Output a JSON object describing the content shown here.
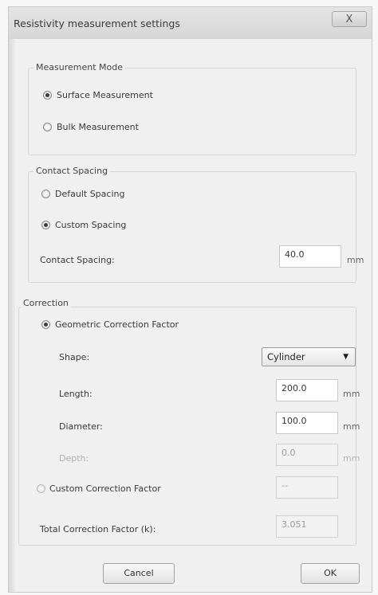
{
  "window": {
    "title": "Resistivity measurement settings",
    "close_label": "X"
  },
  "measurement_mode": {
    "legend": "Measurement Mode",
    "surface_label": "Surface Measurement",
    "bulk_label": "Bulk Measurement",
    "selected": "surface"
  },
  "contact_spacing": {
    "legend": "Contact Spacing",
    "default_label": "Default Spacing",
    "custom_label": "Custom Spacing",
    "selected": "custom",
    "field_label": "Contact Spacing:",
    "value": "40.0",
    "unit": "mm"
  },
  "correction": {
    "legend": "Correction",
    "geometric_label": "Geometric Correction Factor",
    "selected": "geometric",
    "shape_label": "Shape:",
    "shape_value": "Cylinder",
    "length_label": "Length:",
    "length_value": "200.0",
    "length_unit": "mm",
    "diameter_label": "Diameter:",
    "diameter_value": "100.0",
    "diameter_unit": "mm",
    "depth_label": "Depth:",
    "depth_value": "0.0",
    "depth_unit": "mm",
    "custom_label": "Custom Correction Factor",
    "custom_value": "--",
    "total_label": "Total Correction Factor (k):",
    "total_value": "3.051"
  },
  "buttons": {
    "cancel": "Cancel",
    "ok": "OK"
  }
}
